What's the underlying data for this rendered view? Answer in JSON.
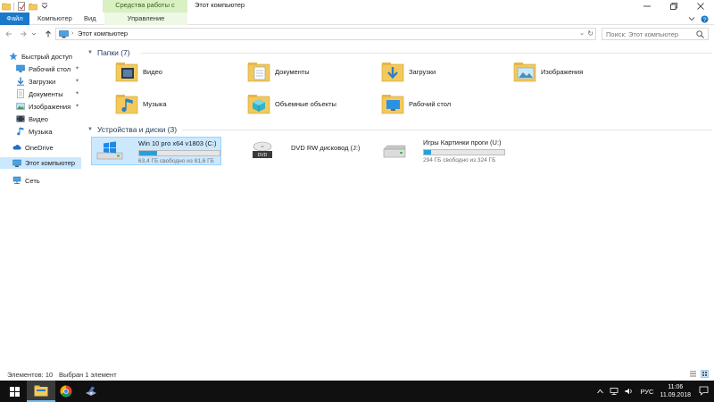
{
  "window": {
    "context_tab_header": "Средства работы с дисками",
    "title": "Этот компьютер",
    "controls": [
      "minimize",
      "maximize",
      "close"
    ]
  },
  "ribbon": {
    "tabs": [
      {
        "label": "Файл",
        "active": true
      },
      {
        "label": "Компьютер"
      },
      {
        "label": "Вид"
      },
      {
        "label": "Управление"
      }
    ]
  },
  "address": {
    "path": "Этот компьютер",
    "search_placeholder": "Поиск: Этот компьютер"
  },
  "sidebar": {
    "quick_access": "Быстрый доступ",
    "quick_items": [
      {
        "label": "Рабочий стол",
        "pinned": true,
        "icon": "desktop-icon"
      },
      {
        "label": "Загрузки",
        "pinned": true,
        "icon": "downloads-icon"
      },
      {
        "label": "Документы",
        "pinned": true,
        "icon": "documents-icon"
      },
      {
        "label": "Изображения",
        "pinned": true,
        "icon": "pictures-icon"
      },
      {
        "label": "Видео",
        "pinned": false,
        "icon": "video-icon"
      },
      {
        "label": "Музыка",
        "pinned": false,
        "icon": "music-icon"
      }
    ],
    "onedrive": "OneDrive",
    "this_pc": "Этот компьютер",
    "network": "Сеть"
  },
  "main": {
    "folders_header": "Папки (7)",
    "folders": [
      {
        "label": "Видео",
        "icon": "video-folder-icon"
      },
      {
        "label": "Документы",
        "icon": "documents-folder-icon"
      },
      {
        "label": "Загрузки",
        "icon": "downloads-folder-icon"
      },
      {
        "label": "Изображения",
        "icon": "pictures-folder-icon"
      },
      {
        "label": "Музыка",
        "icon": "music-folder-icon"
      },
      {
        "label": "Объемные объекты",
        "icon": "3d-objects-folder-icon"
      },
      {
        "label": "Рабочий стол",
        "icon": "desktop-folder-icon"
      }
    ],
    "drives_header": "Устройства и диски (3)",
    "drives": [
      {
        "label": "Win 10 pro x64 v1803 (C:)",
        "free": "63,4 ГБ свободно из 81,6 ГБ",
        "used_fraction": 0.223,
        "selected": true,
        "icon": "windows-drive-icon"
      },
      {
        "label": "DVD RW дисковод (J:)",
        "icon": "dvd-drive-icon"
      },
      {
        "label": "Игры Картинки проги (U:)",
        "free": "294 ГБ свободно из 324 ГБ",
        "used_fraction": 0.093,
        "icon": "hard-drive-icon"
      }
    ]
  },
  "status": {
    "count": "Элементов: 10",
    "selected": "Выбран 1 элемент"
  },
  "taskbar": {
    "language": "РУС",
    "time": "11:06",
    "date": "11.09.2018"
  },
  "colors": {
    "accent": "#1979ca",
    "selection": "#cce8ff",
    "drive_bar": "#26a0da",
    "taskbar": "#101010",
    "disk_tools": "#d9f0c3"
  }
}
